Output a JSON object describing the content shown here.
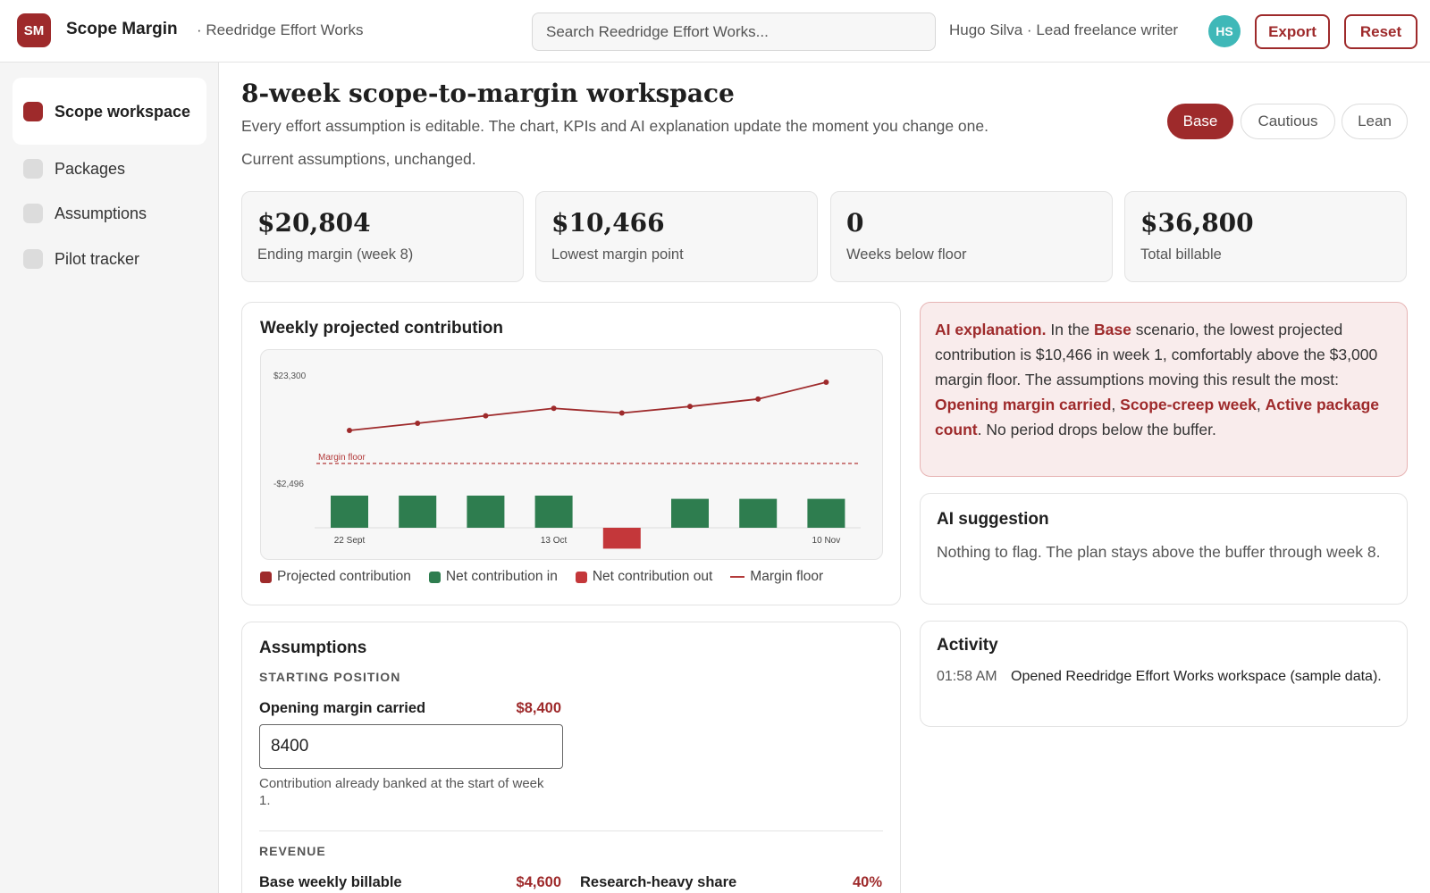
{
  "header": {
    "logo": "SM",
    "app_name": "Scope Margin",
    "org_name": "· Reedridge Effort Works",
    "search_placeholder": "Search Reedridge Effort Works...",
    "user_label": "Hugo Silva · Lead freelance writer",
    "avatar_initials": "HS",
    "export_label": "Export",
    "reset_label": "Reset"
  },
  "sidebar": {
    "items": [
      {
        "label": "Scope workspace",
        "active": true
      },
      {
        "label": "Packages",
        "active": false
      },
      {
        "label": "Assumptions",
        "active": false
      },
      {
        "label": "Pilot tracker",
        "active": false
      }
    ]
  },
  "page": {
    "title": "8-week scope-to-margin workspace",
    "subtitle": "Every effort assumption is editable. The chart, KPIs and AI explanation update the moment you change one.",
    "status": "Current assumptions, unchanged.",
    "scenarios": [
      "Base",
      "Cautious",
      "Lean"
    ],
    "active_scenario": "Base"
  },
  "kpis": [
    {
      "value": "$20,804",
      "label": "Ending margin (week 8)"
    },
    {
      "value": "$10,466",
      "label": "Lowest margin point"
    },
    {
      "value": "0",
      "label": "Weeks below floor"
    },
    {
      "value": "$36,800",
      "label": "Total billable"
    }
  ],
  "chart_panel": {
    "title": "Weekly projected contribution",
    "floor_label": "Margin floor",
    "legend": [
      "Projected contribution",
      "Net contribution in",
      "Net contribution out",
      "Margin floor"
    ]
  },
  "chart_data": {
    "type": "line",
    "y_tick_labels": [
      "$23,300",
      "-$2,496"
    ],
    "x_tick_labels": [
      "22 Sept",
      "13 Oct",
      "10 Nov"
    ],
    "x_tick_weeks": [
      1,
      4,
      8
    ],
    "weeks": [
      1,
      2,
      3,
      4,
      5,
      6,
      7,
      8
    ],
    "series": [
      {
        "name": "Projected contribution",
        "color": "#9e2a2b",
        "values": [
          10466,
          12000,
          13600,
          15200,
          14200,
          15600,
          17200,
          20804
        ]
      },
      {
        "name": "Net contribution",
        "values": [
          2000,
          2000,
          2000,
          2000,
          -1300,
          1800,
          1800,
          1800
        ]
      }
    ],
    "margin_floor": 3000,
    "colors": {
      "positive": "#2e7d4f",
      "negative": "#c4373a",
      "line": "#9e2a2b"
    }
  },
  "ai_explanation": {
    "lead": "AI explanation.",
    "t1": " In the ",
    "scenario": "Base",
    "t2": " scenario, the lowest projected contribution is $10,466 in week 1, comfortably above the $3,000 margin floor. The assumptions moving this result the most: ",
    "d1": "Opening margin carried",
    "sep1": ", ",
    "d2": "Scope-creep week",
    "sep2": ", ",
    "d3": "Active package count",
    "t3": ". No period drops below the buffer."
  },
  "ai_suggestion": {
    "title": "AI suggestion",
    "text": "Nothing to flag. The plan stays above the buffer through week 8."
  },
  "activity": {
    "title": "Activity",
    "items": [
      {
        "time": "01:58 AM",
        "text": "Opened Reedridge Effort Works workspace (sample data)."
      }
    ]
  },
  "assumptions": {
    "title": "Assumptions",
    "starting_label": "STARTING POSITION",
    "opening_label": "Opening margin carried",
    "opening_display": "$8,400",
    "opening_input": "8400",
    "opening_help": "Contribution already banked at the start of week 1.",
    "revenue_label": "REVENUE",
    "billable_label": "Base weekly billable",
    "billable_display": "$4,600",
    "research_label": "Research-heavy share",
    "research_display": "40%"
  },
  "colors": {
    "accent": "#9e2a2b",
    "positive": "#2e7d4f",
    "negative": "#c4373a",
    "avatar": "#3fb8b8"
  }
}
